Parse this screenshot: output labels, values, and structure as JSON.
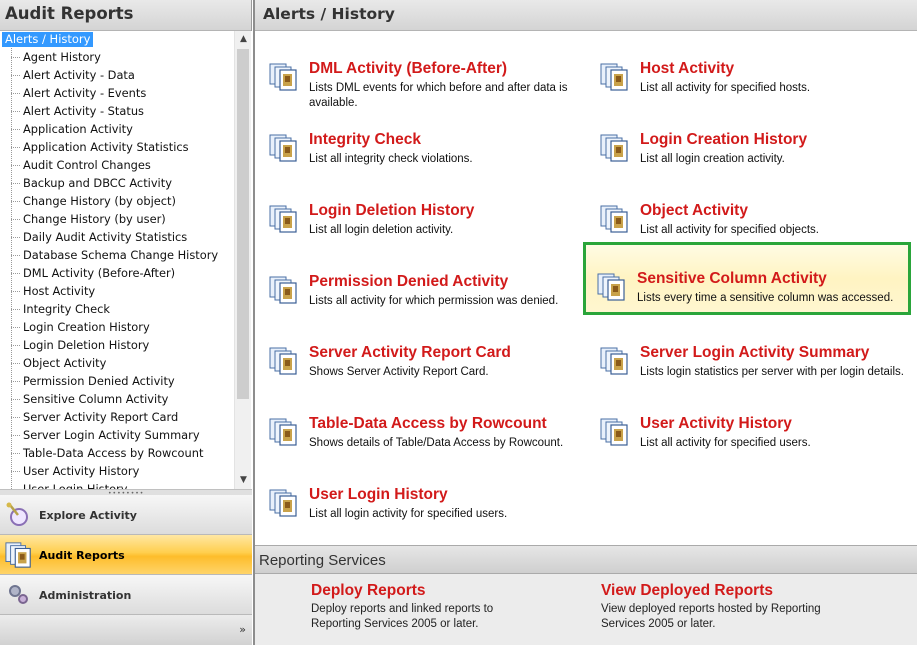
{
  "sidebar": {
    "title": "Audit Reports",
    "tree_root": "Alerts /  History",
    "items": [
      "Agent History",
      "Alert Activity - Data",
      "Alert Activity - Events",
      "Alert Activity - Status",
      "Application Activity",
      "Application Activity Statistics",
      "Audit Control Changes",
      "Backup and DBCC Activity",
      "Change History (by object)",
      "Change History (by user)",
      "Daily Audit Activity Statistics",
      "Database Schema Change History",
      "DML Activity (Before-After)",
      "Host Activity",
      "Integrity Check",
      "Login Creation History",
      "Login Deletion History",
      "Object Activity",
      "Permission Denied Activity",
      "Sensitive Column Activity",
      "Server Activity Report Card",
      "Server Login Activity Summary",
      "Table-Data Access by Rowcount",
      "User Activity History",
      "User Login History"
    ],
    "nav": {
      "explore": "Explore Activity",
      "audit": "Audit Reports",
      "admin": "Administration",
      "footer_icon": "expand-chevron-icon"
    }
  },
  "main": {
    "title": "Alerts /  History",
    "reports": [
      {
        "title": "DML Activity (Before-After)",
        "desc": "Lists DML events for which before and after data is available."
      },
      {
        "title": "Host Activity",
        "desc": "List all activity for specified hosts."
      },
      {
        "title": "Integrity Check",
        "desc": "List all integrity check violations."
      },
      {
        "title": "Login Creation History",
        "desc": "List all login creation activity."
      },
      {
        "title": "Login Deletion History",
        "desc": "List all login deletion activity."
      },
      {
        "title": "Object Activity",
        "desc": "List all activity for specified objects."
      },
      {
        "title": "Permission Denied Activity",
        "desc": "Lists all activity for which permission was denied."
      },
      {
        "title": "Sensitive Column Activity",
        "desc": "Lists every time a sensitive column was accessed."
      },
      {
        "title": "Server Activity Report Card",
        "desc": "Shows Server Activity Report Card."
      },
      {
        "title": "Server Login Activity Summary",
        "desc": "Lists login statistics per server with per login details."
      },
      {
        "title": "Table-Data Access by Rowcount",
        "desc": "Shows details of Table/Data Access by Rowcount."
      },
      {
        "title": "User Activity History",
        "desc": "List all activity for specified users."
      },
      {
        "title": "User Login History",
        "desc": "List all login activity for specified users."
      }
    ],
    "reporting_services": {
      "title": "Reporting Services",
      "items": [
        {
          "title": "Deploy Reports",
          "desc": "Deploy reports and linked reports to Reporting Services 2005 or later."
        },
        {
          "title": "View Deployed Reports",
          "desc": "View deployed reports hosted by Reporting Services 2005 or later."
        }
      ]
    }
  },
  "colors": {
    "link_red": "#d21a1a",
    "highlight_border": "#2aa53a",
    "tree_selection": "#3399ff"
  }
}
